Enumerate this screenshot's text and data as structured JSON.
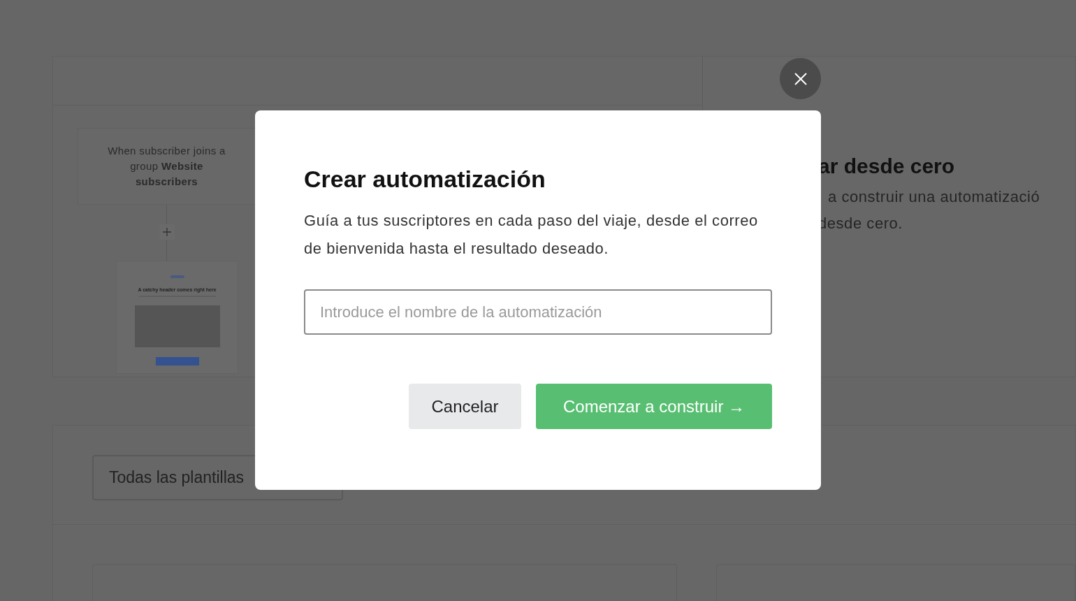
{
  "background": {
    "trigger_card": {
      "text": "When subscriber joins a group **Website subscribers**"
    },
    "email_preview": {
      "headline": "A catchy header comes right here"
    },
    "scratch_panel": {
      "title": "ar desde cero",
      "description_lines": [
        "a construir una automatizació",
        "desde cero."
      ]
    },
    "template_filter": {
      "value": "Todas las plantillas"
    }
  },
  "modal": {
    "title": "Crear automatización",
    "description": "Guía a tus suscriptores en cada paso del viaje, desde el correo de bienvenida hasta el resultado deseado.",
    "name_field": {
      "placeholder": "Introduce el nombre de la automatización"
    },
    "buttons": [
      {
        "kind": "secondary",
        "label": "Cancelar"
      },
      {
        "kind": "primary",
        "label": "Comenzar a construir →"
      }
    ]
  }
}
